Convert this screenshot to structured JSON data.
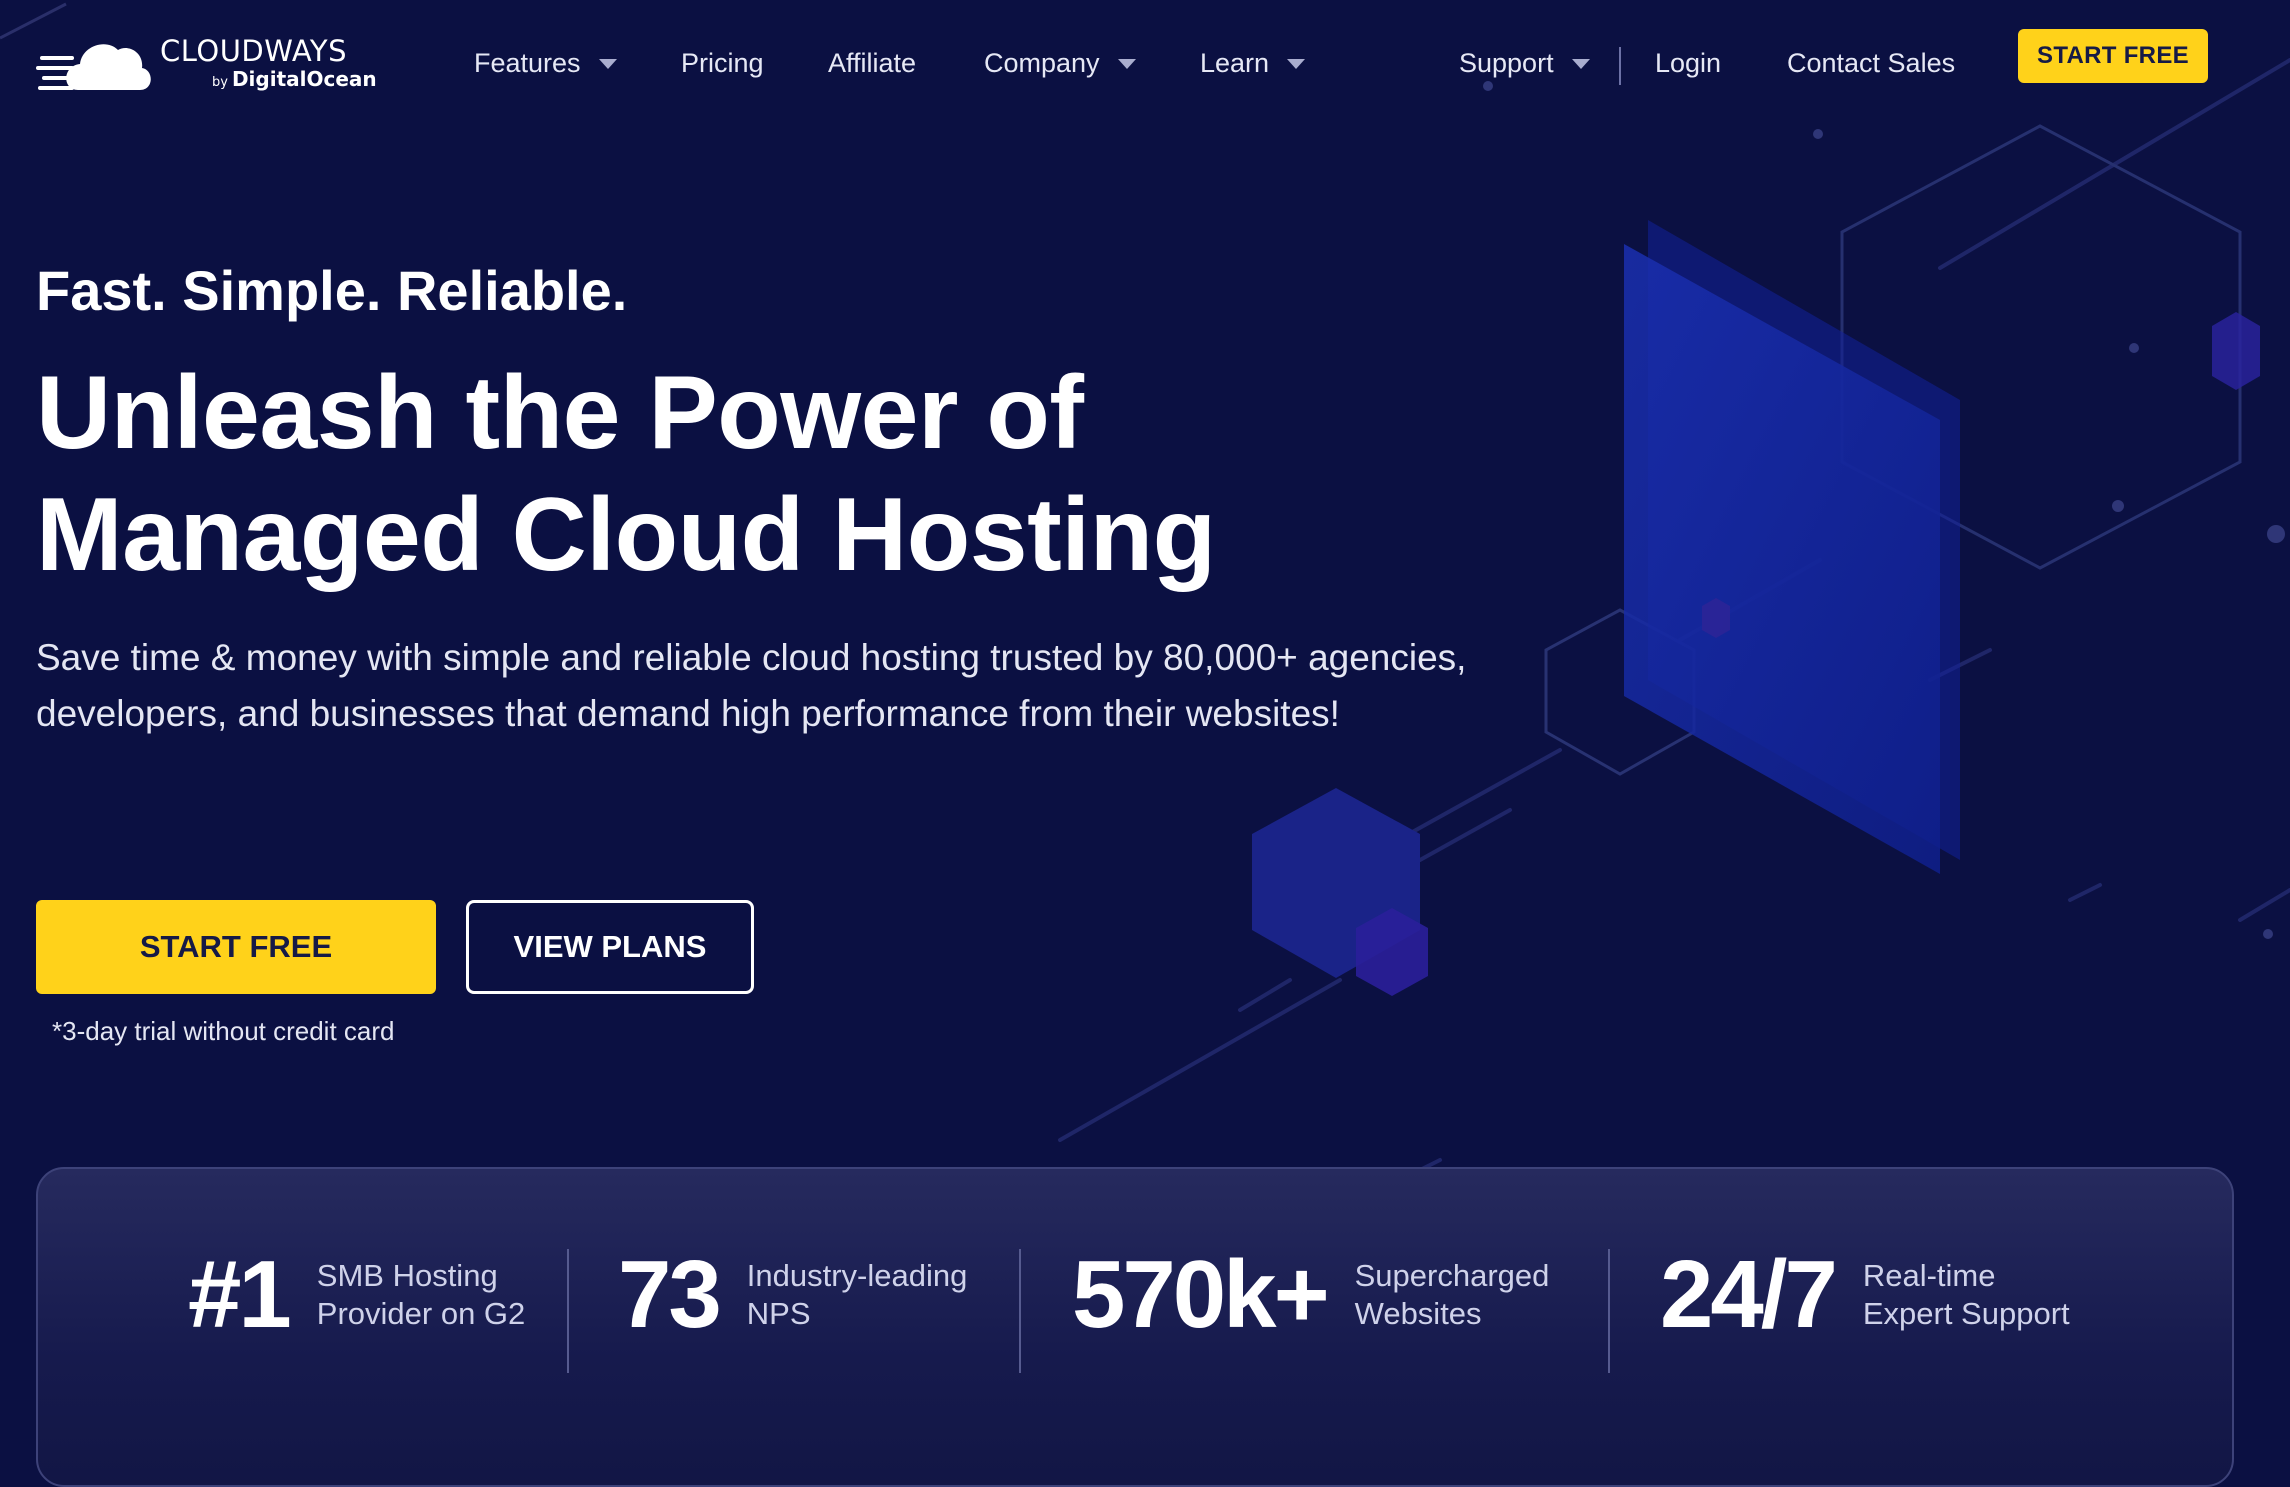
{
  "brand": {
    "name": "CLOUDWAYS",
    "by": "by",
    "parent": "DigitalOcean"
  },
  "nav": {
    "features": "Features",
    "pricing": "Pricing",
    "affiliate": "Affiliate",
    "company": "Company",
    "learn": "Learn",
    "support": "Support",
    "login": "Login",
    "contact_sales": "Contact Sales",
    "start_free": "START FREE"
  },
  "hero": {
    "tagline": "Fast. Simple. Reliable.",
    "headline_line1": "Unleash the Power of",
    "headline_line2": "Managed Cloud Hosting",
    "description": "Save time & money with simple and reliable cloud hosting trusted by 80,000+ agencies, developers, and businesses that demand high performance from their websites!",
    "cta_primary": "START FREE",
    "cta_secondary": "VIEW PLANS",
    "trial_note": "*3-day trial without credit card"
  },
  "stats": [
    {
      "value": "#1",
      "label_line1": "SMB Hosting",
      "label_line2": "Provider on G2"
    },
    {
      "value": "73",
      "label_line1": "Industry-leading",
      "label_line2": "NPS"
    },
    {
      "value": "570k+",
      "label_line1": "Supercharged",
      "label_line2": "Websites"
    },
    {
      "value": "24/7",
      "label_line1": "Real-time",
      "label_line2": "Expert Support"
    }
  ],
  "colors": {
    "background": "#0b1042",
    "accent_yellow": "#ffd21a",
    "button_text": "#161a46",
    "stats_card": "#1c2054"
  },
  "icons": {
    "logo": "cloud-logo-icon",
    "dropdown": "caret-down-icon"
  }
}
